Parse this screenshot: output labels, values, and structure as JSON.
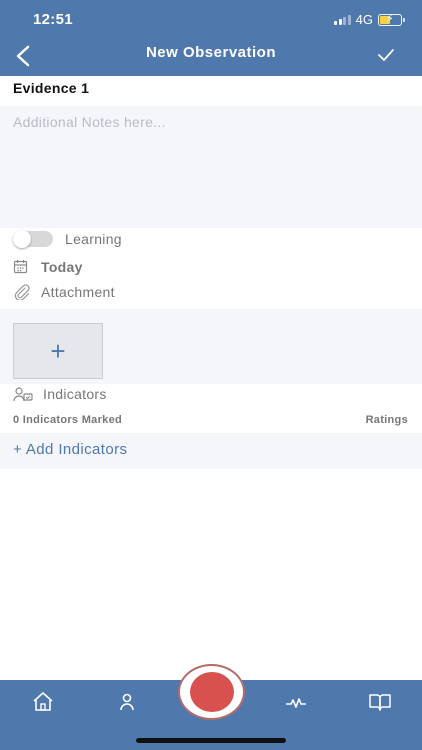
{
  "status": {
    "time": "12:51",
    "network": "4G"
  },
  "header": {
    "title": "New Observation"
  },
  "evidence": {
    "title": "Evidence 1",
    "notes_placeholder": "Additional Notes here...",
    "notes_value": ""
  },
  "options": {
    "learning_label": "Learning",
    "learning_on": false,
    "date_label": "Today",
    "attachment_label": "Attachment",
    "add_attachment_symbol": "+"
  },
  "indicators": {
    "label": "Indicators",
    "marked_text": "0 Indicators Marked",
    "ratings_label": "Ratings",
    "add_label": "+ Add Indicators"
  },
  "bottom_nav": {
    "items": [
      "home-icon",
      "profile-icon",
      "record-button",
      "activity-icon",
      "book-icon"
    ]
  },
  "colors": {
    "brand": "#4f79ad",
    "record": "#d9514f",
    "panel": "#f4f6fa"
  }
}
